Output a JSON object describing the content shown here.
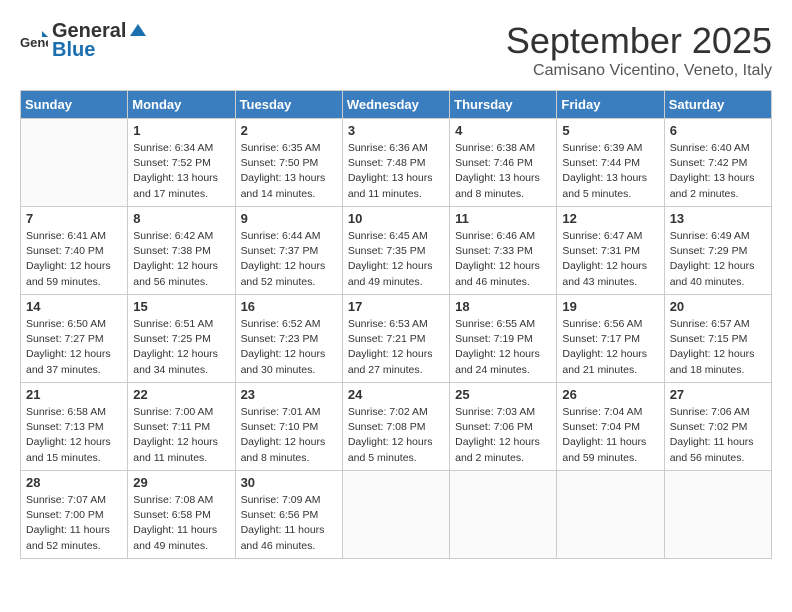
{
  "logo": {
    "general": "General",
    "blue": "Blue"
  },
  "title": "September 2025",
  "subtitle": "Camisano Vicentino, Veneto, Italy",
  "days_of_week": [
    "Sunday",
    "Monday",
    "Tuesday",
    "Wednesday",
    "Thursday",
    "Friday",
    "Saturday"
  ],
  "weeks": [
    [
      {
        "day": "",
        "info": ""
      },
      {
        "day": "1",
        "info": "Sunrise: 6:34 AM\nSunset: 7:52 PM\nDaylight: 13 hours\nand 17 minutes."
      },
      {
        "day": "2",
        "info": "Sunrise: 6:35 AM\nSunset: 7:50 PM\nDaylight: 13 hours\nand 14 minutes."
      },
      {
        "day": "3",
        "info": "Sunrise: 6:36 AM\nSunset: 7:48 PM\nDaylight: 13 hours\nand 11 minutes."
      },
      {
        "day": "4",
        "info": "Sunrise: 6:38 AM\nSunset: 7:46 PM\nDaylight: 13 hours\nand 8 minutes."
      },
      {
        "day": "5",
        "info": "Sunrise: 6:39 AM\nSunset: 7:44 PM\nDaylight: 13 hours\nand 5 minutes."
      },
      {
        "day": "6",
        "info": "Sunrise: 6:40 AM\nSunset: 7:42 PM\nDaylight: 13 hours\nand 2 minutes."
      }
    ],
    [
      {
        "day": "7",
        "info": "Sunrise: 6:41 AM\nSunset: 7:40 PM\nDaylight: 12 hours\nand 59 minutes."
      },
      {
        "day": "8",
        "info": "Sunrise: 6:42 AM\nSunset: 7:38 PM\nDaylight: 12 hours\nand 56 minutes."
      },
      {
        "day": "9",
        "info": "Sunrise: 6:44 AM\nSunset: 7:37 PM\nDaylight: 12 hours\nand 52 minutes."
      },
      {
        "day": "10",
        "info": "Sunrise: 6:45 AM\nSunset: 7:35 PM\nDaylight: 12 hours\nand 49 minutes."
      },
      {
        "day": "11",
        "info": "Sunrise: 6:46 AM\nSunset: 7:33 PM\nDaylight: 12 hours\nand 46 minutes."
      },
      {
        "day": "12",
        "info": "Sunrise: 6:47 AM\nSunset: 7:31 PM\nDaylight: 12 hours\nand 43 minutes."
      },
      {
        "day": "13",
        "info": "Sunrise: 6:49 AM\nSunset: 7:29 PM\nDaylight: 12 hours\nand 40 minutes."
      }
    ],
    [
      {
        "day": "14",
        "info": "Sunrise: 6:50 AM\nSunset: 7:27 PM\nDaylight: 12 hours\nand 37 minutes."
      },
      {
        "day": "15",
        "info": "Sunrise: 6:51 AM\nSunset: 7:25 PM\nDaylight: 12 hours\nand 34 minutes."
      },
      {
        "day": "16",
        "info": "Sunrise: 6:52 AM\nSunset: 7:23 PM\nDaylight: 12 hours\nand 30 minutes."
      },
      {
        "day": "17",
        "info": "Sunrise: 6:53 AM\nSunset: 7:21 PM\nDaylight: 12 hours\nand 27 minutes."
      },
      {
        "day": "18",
        "info": "Sunrise: 6:55 AM\nSunset: 7:19 PM\nDaylight: 12 hours\nand 24 minutes."
      },
      {
        "day": "19",
        "info": "Sunrise: 6:56 AM\nSunset: 7:17 PM\nDaylight: 12 hours\nand 21 minutes."
      },
      {
        "day": "20",
        "info": "Sunrise: 6:57 AM\nSunset: 7:15 PM\nDaylight: 12 hours\nand 18 minutes."
      }
    ],
    [
      {
        "day": "21",
        "info": "Sunrise: 6:58 AM\nSunset: 7:13 PM\nDaylight: 12 hours\nand 15 minutes."
      },
      {
        "day": "22",
        "info": "Sunrise: 7:00 AM\nSunset: 7:11 PM\nDaylight: 12 hours\nand 11 minutes."
      },
      {
        "day": "23",
        "info": "Sunrise: 7:01 AM\nSunset: 7:10 PM\nDaylight: 12 hours\nand 8 minutes."
      },
      {
        "day": "24",
        "info": "Sunrise: 7:02 AM\nSunset: 7:08 PM\nDaylight: 12 hours\nand 5 minutes."
      },
      {
        "day": "25",
        "info": "Sunrise: 7:03 AM\nSunset: 7:06 PM\nDaylight: 12 hours\nand 2 minutes."
      },
      {
        "day": "26",
        "info": "Sunrise: 7:04 AM\nSunset: 7:04 PM\nDaylight: 11 hours\nand 59 minutes."
      },
      {
        "day": "27",
        "info": "Sunrise: 7:06 AM\nSunset: 7:02 PM\nDaylight: 11 hours\nand 56 minutes."
      }
    ],
    [
      {
        "day": "28",
        "info": "Sunrise: 7:07 AM\nSunset: 7:00 PM\nDaylight: 11 hours\nand 52 minutes."
      },
      {
        "day": "29",
        "info": "Sunrise: 7:08 AM\nSunset: 6:58 PM\nDaylight: 11 hours\nand 49 minutes."
      },
      {
        "day": "30",
        "info": "Sunrise: 7:09 AM\nSunset: 6:56 PM\nDaylight: 11 hours\nand 46 minutes."
      },
      {
        "day": "",
        "info": ""
      },
      {
        "day": "",
        "info": ""
      },
      {
        "day": "",
        "info": ""
      },
      {
        "day": "",
        "info": ""
      }
    ]
  ]
}
